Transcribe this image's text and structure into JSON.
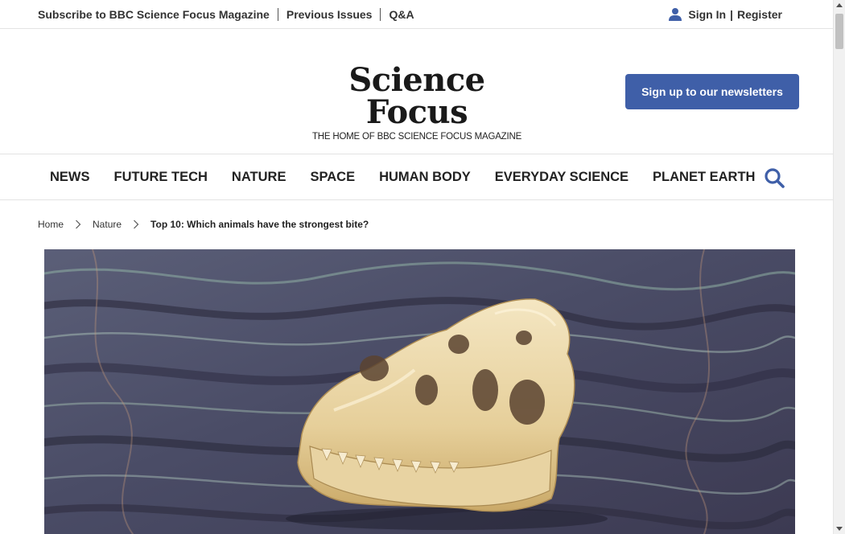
{
  "topbar": {
    "links": [
      {
        "label": "Subscribe to BBC Science Focus Magazine"
      },
      {
        "label": "Previous Issues"
      },
      {
        "label": "Q&A"
      }
    ],
    "account": {
      "icon": "user-icon",
      "sign_in": "Sign In",
      "separator": "|",
      "register": "Register"
    }
  },
  "header": {
    "logo_text": "Science Focus",
    "tagline": "THE HOME OF BBC SCIENCE FOCUS MAGAZINE",
    "newsletter_button": "Sign up to our newsletters",
    "accent_color": "#3f5fa8"
  },
  "nav": {
    "items": [
      {
        "label": "NEWS"
      },
      {
        "label": "FUTURE TECH"
      },
      {
        "label": "NATURE"
      },
      {
        "label": "SPACE"
      },
      {
        "label": "HUMAN BODY"
      },
      {
        "label": "EVERYDAY SCIENCE"
      },
      {
        "label": "PLANET EARTH"
      }
    ],
    "search_icon": "search-icon",
    "search_icon_color": "#3f5fa8"
  },
  "breadcrumb": {
    "items": [
      {
        "label": "Home"
      },
      {
        "label": "Nature"
      }
    ],
    "current": "Top 10: Which animals have the strongest bite?"
  },
  "hero": {
    "subject": "skull-on-rock"
  }
}
